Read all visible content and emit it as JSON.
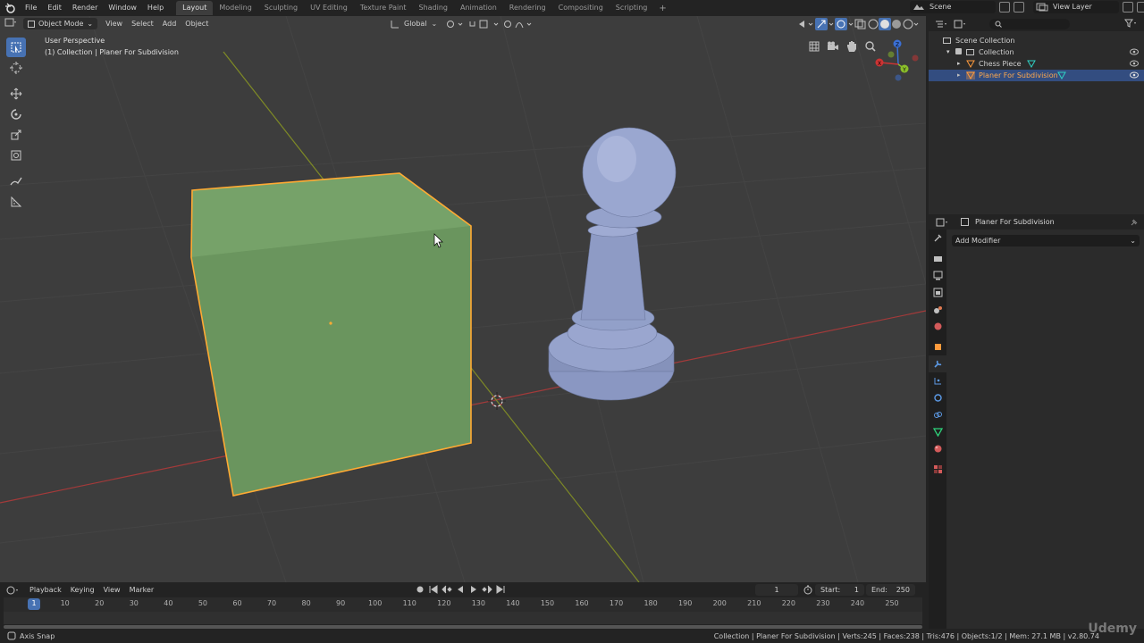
{
  "top_menu": {
    "items": [
      "File",
      "Edit",
      "Render",
      "Window",
      "Help"
    ]
  },
  "workspaces": [
    {
      "label": "Layout",
      "active": true
    },
    {
      "label": "Modeling",
      "active": false
    },
    {
      "label": "Sculpting",
      "active": false
    },
    {
      "label": "UV Editing",
      "active": false
    },
    {
      "label": "Texture Paint",
      "active": false
    },
    {
      "label": "Shading",
      "active": false
    },
    {
      "label": "Animation",
      "active": false
    },
    {
      "label": "Rendering",
      "active": false
    },
    {
      "label": "Compositing",
      "active": false
    },
    {
      "label": "Scripting",
      "active": false
    }
  ],
  "scene": {
    "name": "Scene",
    "view_layer": "View Layer"
  },
  "viewport": {
    "mode": "Object Mode",
    "menus": [
      "View",
      "Select",
      "Add",
      "Object"
    ],
    "transform_orientation": "Global",
    "perspective_label": "User Perspective",
    "context_label": "(1) Collection | Planer For Subdivision",
    "gizmo_axes": {
      "x": "X",
      "y": "Y",
      "z": "Z"
    }
  },
  "outliner": {
    "rows": [
      {
        "label": "Scene Collection",
        "level": 0,
        "selected": false
      },
      {
        "label": "Collection",
        "level": 1,
        "selected": false
      },
      {
        "label": "Chess Piece",
        "level": 2,
        "selected": false
      },
      {
        "label": "Planer For Subdivision",
        "level": 2,
        "selected": true
      }
    ]
  },
  "properties": {
    "object_name": "Planer For Subdivision",
    "add_modifier_label": "Add Modifier"
  },
  "timeline": {
    "menus": [
      "Playback",
      "Keying",
      "View",
      "Marker"
    ],
    "current_frame": "1",
    "start_label": "Start:",
    "start_value": "1",
    "end_label": "End:",
    "end_value": "250",
    "ticks": [
      "1",
      "10",
      "20",
      "30",
      "40",
      "50",
      "60",
      "70",
      "80",
      "90",
      "100",
      "110",
      "120",
      "130",
      "140",
      "150",
      "160",
      "170",
      "180",
      "190",
      "200",
      "210",
      "220",
      "230",
      "240",
      "250"
    ]
  },
  "status": {
    "left": "Axis Snap",
    "right": "Collection | Planer For Subdivision | Verts:245 | Faces:238 | Tris:476 | Objects:1/2 | Mem: 27.1 MB | v2.80.74"
  },
  "watermark": "Udemy",
  "colors": {
    "accent": "#4772b3",
    "selection_outline": "#ffaa33",
    "cube_fill": "#6e9a62",
    "pawn_fill": "#8a97c2",
    "axis_x": "#b03a3a",
    "axis_y": "#8b9a2a"
  }
}
